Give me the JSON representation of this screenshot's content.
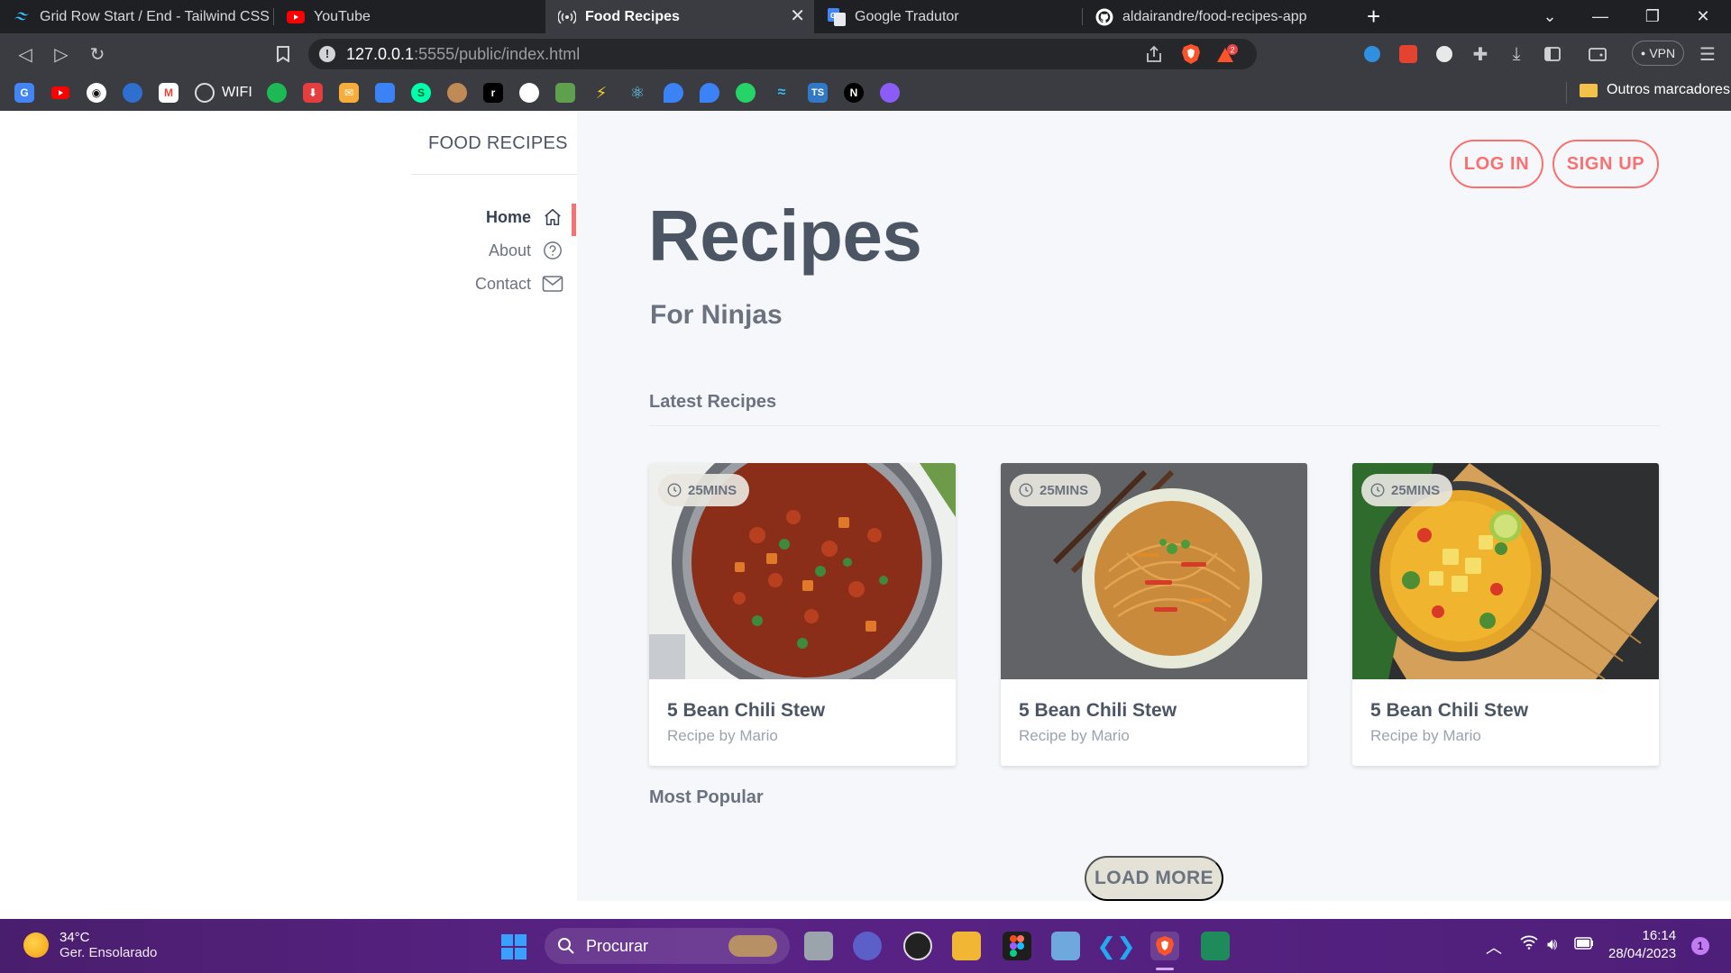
{
  "browser": {
    "tabs": [
      {
        "label": "Grid Row Start / End - Tailwind CSS",
        "icon": "tailwind-icon"
      },
      {
        "label": "YouTube",
        "icon": "youtube-icon"
      },
      {
        "label": "Food Recipes",
        "icon": "broadcast-icon",
        "active": true
      },
      {
        "label": "Google Tradutor",
        "icon": "google-translate-icon"
      },
      {
        "label": "aldairandre/food-recipes-app",
        "icon": "github-icon"
      }
    ],
    "new_tab": "+",
    "url_host": "127.0.0.1",
    "url_rest": ":5555/public/index.html",
    "vpn_label": "VPN",
    "bookmarks": {
      "wifi_label": "WIFI",
      "other_bookmarks": "Outros marcadores",
      "ts_label": "TS",
      "n_label": "N"
    },
    "brave_badge": "2"
  },
  "page": {
    "brand": "FOOD RECIPES",
    "nav": [
      {
        "label": "Home",
        "icon": "home-icon",
        "active": true
      },
      {
        "label": "About",
        "icon": "question-circle-icon"
      },
      {
        "label": "Contact",
        "icon": "mail-icon"
      }
    ],
    "auth": {
      "login": "LOG IN",
      "signup": "SIGN UP"
    },
    "hero": {
      "title": "Recipes",
      "subtitle": "For Ninjas"
    },
    "latest_heading": "Latest Recipes",
    "popular_heading": "Most Popular",
    "cards": [
      {
        "time": "25MINS",
        "title": "5 Bean Chili Stew",
        "author": "Recipe by Mario"
      },
      {
        "time": "25MINS",
        "title": "5 Bean Chili Stew",
        "author": "Recipe by Mario"
      },
      {
        "time": "25MINS",
        "title": "5 Bean Chili Stew",
        "author": "Recipe by Mario"
      }
    ],
    "load_more": "LOAD MORE"
  },
  "taskbar": {
    "temperature": "34°C",
    "weather": "Ger. Ensolarado",
    "search_placeholder": "Procurar",
    "time": "16:14",
    "date": "28/04/2023",
    "notification_count": "1"
  },
  "colors": {
    "accent": "#f87171",
    "main_bg": "#f5f7fa",
    "text_dark": "#4b5563",
    "text_muted": "#9ca3af",
    "chrome_dark": "#1f2023",
    "chrome_mid": "#3a3c41"
  }
}
